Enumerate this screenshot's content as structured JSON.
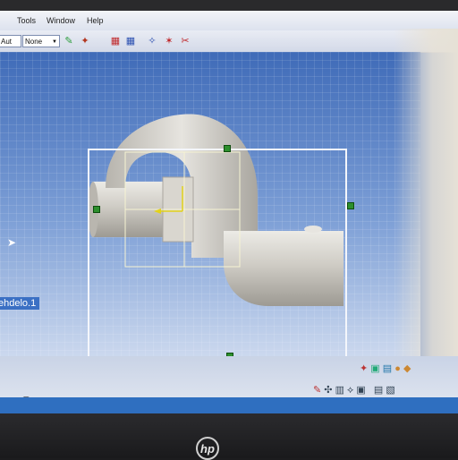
{
  "menu": {
    "items": [
      "Tools",
      "Window",
      "Help"
    ]
  },
  "toolbar": {
    "combo_left": "Aut",
    "combo_right": "None"
  },
  "tree": {
    "selected_node": "ehdelo.1"
  },
  "formula_icon": "f(x)",
  "brand": "hp",
  "colors": {
    "viewport_top": "#3f6bb8",
    "viewport_bottom": "#cbd8ee",
    "part": "#c9c6bf",
    "selection_handle": "#2d8f2d",
    "tree_highlight": "#3b70c4"
  }
}
